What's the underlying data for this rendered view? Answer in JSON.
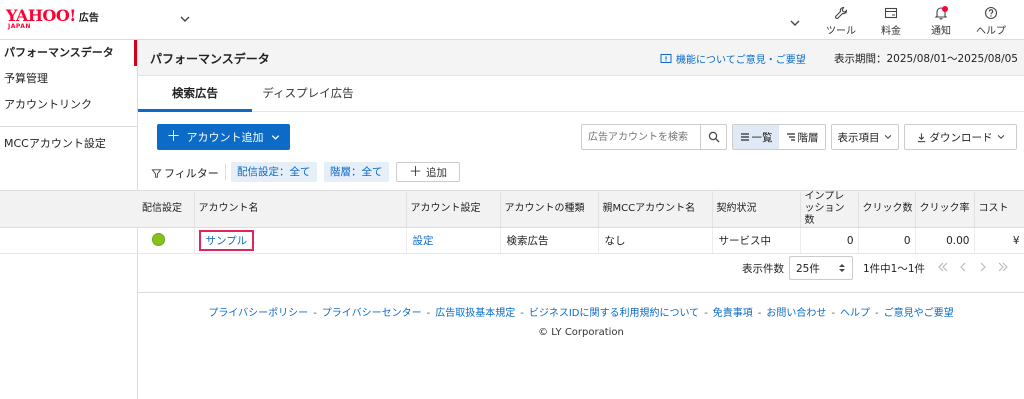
{
  "header": {
    "logo_main": "YAHOO!",
    "logo_ad": "広告",
    "logo_sub": "JAPAN",
    "tools": [
      {
        "label": "ツール",
        "icon": "wrench-icon"
      },
      {
        "label": "料金",
        "icon": "billing-icon"
      },
      {
        "label": "通知",
        "icon": "bell-icon"
      },
      {
        "label": "ヘルプ",
        "icon": "help-icon"
      }
    ]
  },
  "sidebar": {
    "items": [
      {
        "label": "パフォーマンスデータ",
        "active": true
      },
      {
        "label": "予算管理"
      },
      {
        "label": "アカウントリンク"
      }
    ],
    "section_item": "MCCアカウント設定"
  },
  "main": {
    "title": "パフォーマンスデータ",
    "feedback": "機能についてご意見・ご要望",
    "period": "表示期間：2025/08/01〜2025/08/05",
    "tabs": [
      {
        "label": "検索広告",
        "active": true
      },
      {
        "label": "ディスプレイ広告"
      }
    ],
    "toolbar": {
      "add_account": "アカウント追加",
      "search_placeholder": "広告アカウントを検索",
      "view_list": "一覧",
      "view_tree": "階層",
      "columns": "表示項目",
      "download": "ダウンロード"
    },
    "filter": {
      "label": "フィルター",
      "chips": [
        "配信設定：全て",
        "階層：全て"
      ],
      "add": "追加"
    },
    "table": {
      "headers": [
        "配信設定",
        "アカウント名",
        "アカウント設定",
        "アカウントの種類",
        "親MCCアカウント名",
        "契約状況",
        "インプレッション数",
        "クリック数",
        "クリック率",
        "コスト"
      ],
      "rows": [
        {
          "status_color": "#86c21a",
          "name": "サンプル",
          "settings": "設定",
          "type": "検索広告",
          "parent": "なし",
          "contract": "サービス中",
          "impressions": "0",
          "clicks": "0",
          "ctr": "0.00",
          "cost": "¥"
        }
      ]
    },
    "pager": {
      "label": "表示件数",
      "per_page": "25件",
      "count": "1件中1〜1件"
    }
  },
  "footer": {
    "links": [
      "プライバシーポリシー",
      "プライバシーセンター",
      "広告取扱基本規定",
      "ビジネスIDに関する利用規約について",
      "免責事項",
      "お問い合わせ",
      "ヘルプ",
      "ご意見やご要望"
    ],
    "separator": "-",
    "copyright": "© LY Corporation"
  },
  "colors": {
    "accent": "#0b6bc7",
    "brand": "#ff0033",
    "highlight_border": "#e0245e",
    "status_active": "#86c21a"
  }
}
